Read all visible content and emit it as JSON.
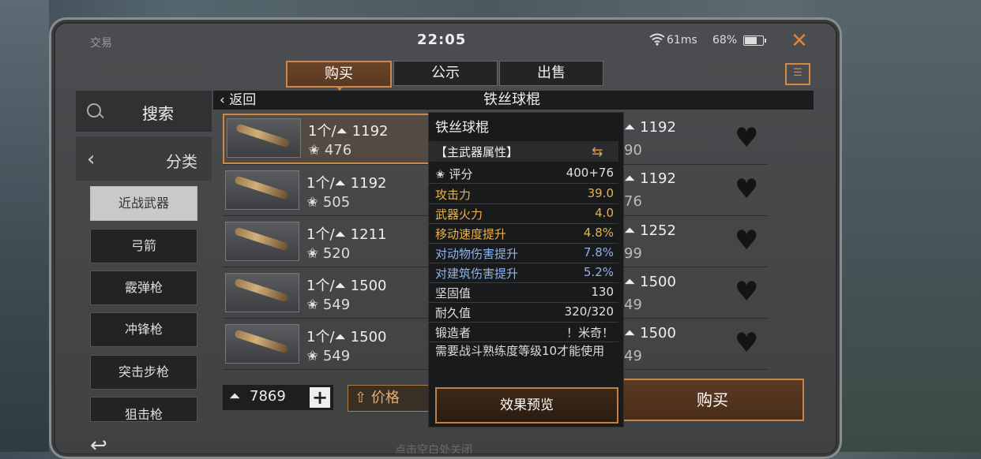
{
  "status_bar": {
    "app_name": "交易",
    "time": "22:05",
    "ping": "61ms",
    "battery": "68%",
    "battery_level": 0.68
  },
  "tabs": [
    {
      "label": "购买",
      "active": true
    },
    {
      "label": "公示",
      "active": false
    },
    {
      "label": "出售",
      "active": false
    }
  ],
  "sidebar": {
    "search_label": "搜索",
    "category_label": "分类",
    "categories": [
      {
        "label": "近战武器",
        "active": true
      },
      {
        "label": "弓箭",
        "active": false
      },
      {
        "label": "霰弹枪",
        "active": false
      },
      {
        "label": "冲锋枪",
        "active": false
      },
      {
        "label": "突击步枪",
        "active": false
      },
      {
        "label": "狙击枪",
        "active": false
      }
    ]
  },
  "list_header": {
    "back_label": "返回",
    "title": "铁丝球棍"
  },
  "listings": [
    {
      "qty": "1个/",
      "price": "1192",
      "score": "476"
    },
    {
      "qty": "1个/",
      "price": "1192",
      "score": "505"
    },
    {
      "qty": "1个/",
      "price": "1211",
      "score": "520"
    },
    {
      "qty": "1个/",
      "price": "1500",
      "score": "549"
    },
    {
      "qty": "1个/",
      "price": "1500",
      "score": "549"
    }
  ],
  "listings_right": [
    {
      "price": "1192",
      "score": "90"
    },
    {
      "price": "1192",
      "score": "76"
    },
    {
      "price": "1252",
      "score": "99"
    },
    {
      "price": "1500",
      "score": "49"
    },
    {
      "price": "1500",
      "score": "49"
    }
  ],
  "footer": {
    "funds": "7869",
    "plus_label": "+",
    "sort_label": "价格",
    "buy_label": "购买",
    "hint": "点击空白处关闭"
  },
  "tooltip": {
    "title": "铁丝球棍",
    "section": "【主武器属性】",
    "score_label": "评分",
    "score_value": "400+76",
    "stats": [
      {
        "label": "攻击力",
        "value": "39.0",
        "color": "gold"
      },
      {
        "label": "武器火力",
        "value": "4.0",
        "color": "gold"
      },
      {
        "label": "移动速度提升",
        "value": "4.8%",
        "color": "gold"
      },
      {
        "label": "对动物伤害提升",
        "value": "7.8%",
        "color": "blue"
      },
      {
        "label": "对建筑伤害提升",
        "value": "5.2%",
        "color": "blue"
      },
      {
        "label": "坚固值",
        "value": "130",
        "color": "white"
      },
      {
        "label": "耐久值",
        "value": "320/320",
        "color": "white"
      },
      {
        "label": "锻造者",
        "value": "！米奇！",
        "color": "white"
      }
    ],
    "requirement": "需要战斗熟练度等级10才能使用",
    "preview_label": "效果预览"
  },
  "colors": {
    "accent": "#c9884c",
    "gold_stat": "#e8b24a",
    "blue_stat": "#8fb4e8"
  },
  "icons": [
    "wifi-icon",
    "battery-icon",
    "close-icon",
    "clipboard-icon",
    "search-icon",
    "chevron-left-icon",
    "currency-icon",
    "score-icon",
    "heart-icon",
    "swap-icon",
    "back-arrow-icon"
  ]
}
